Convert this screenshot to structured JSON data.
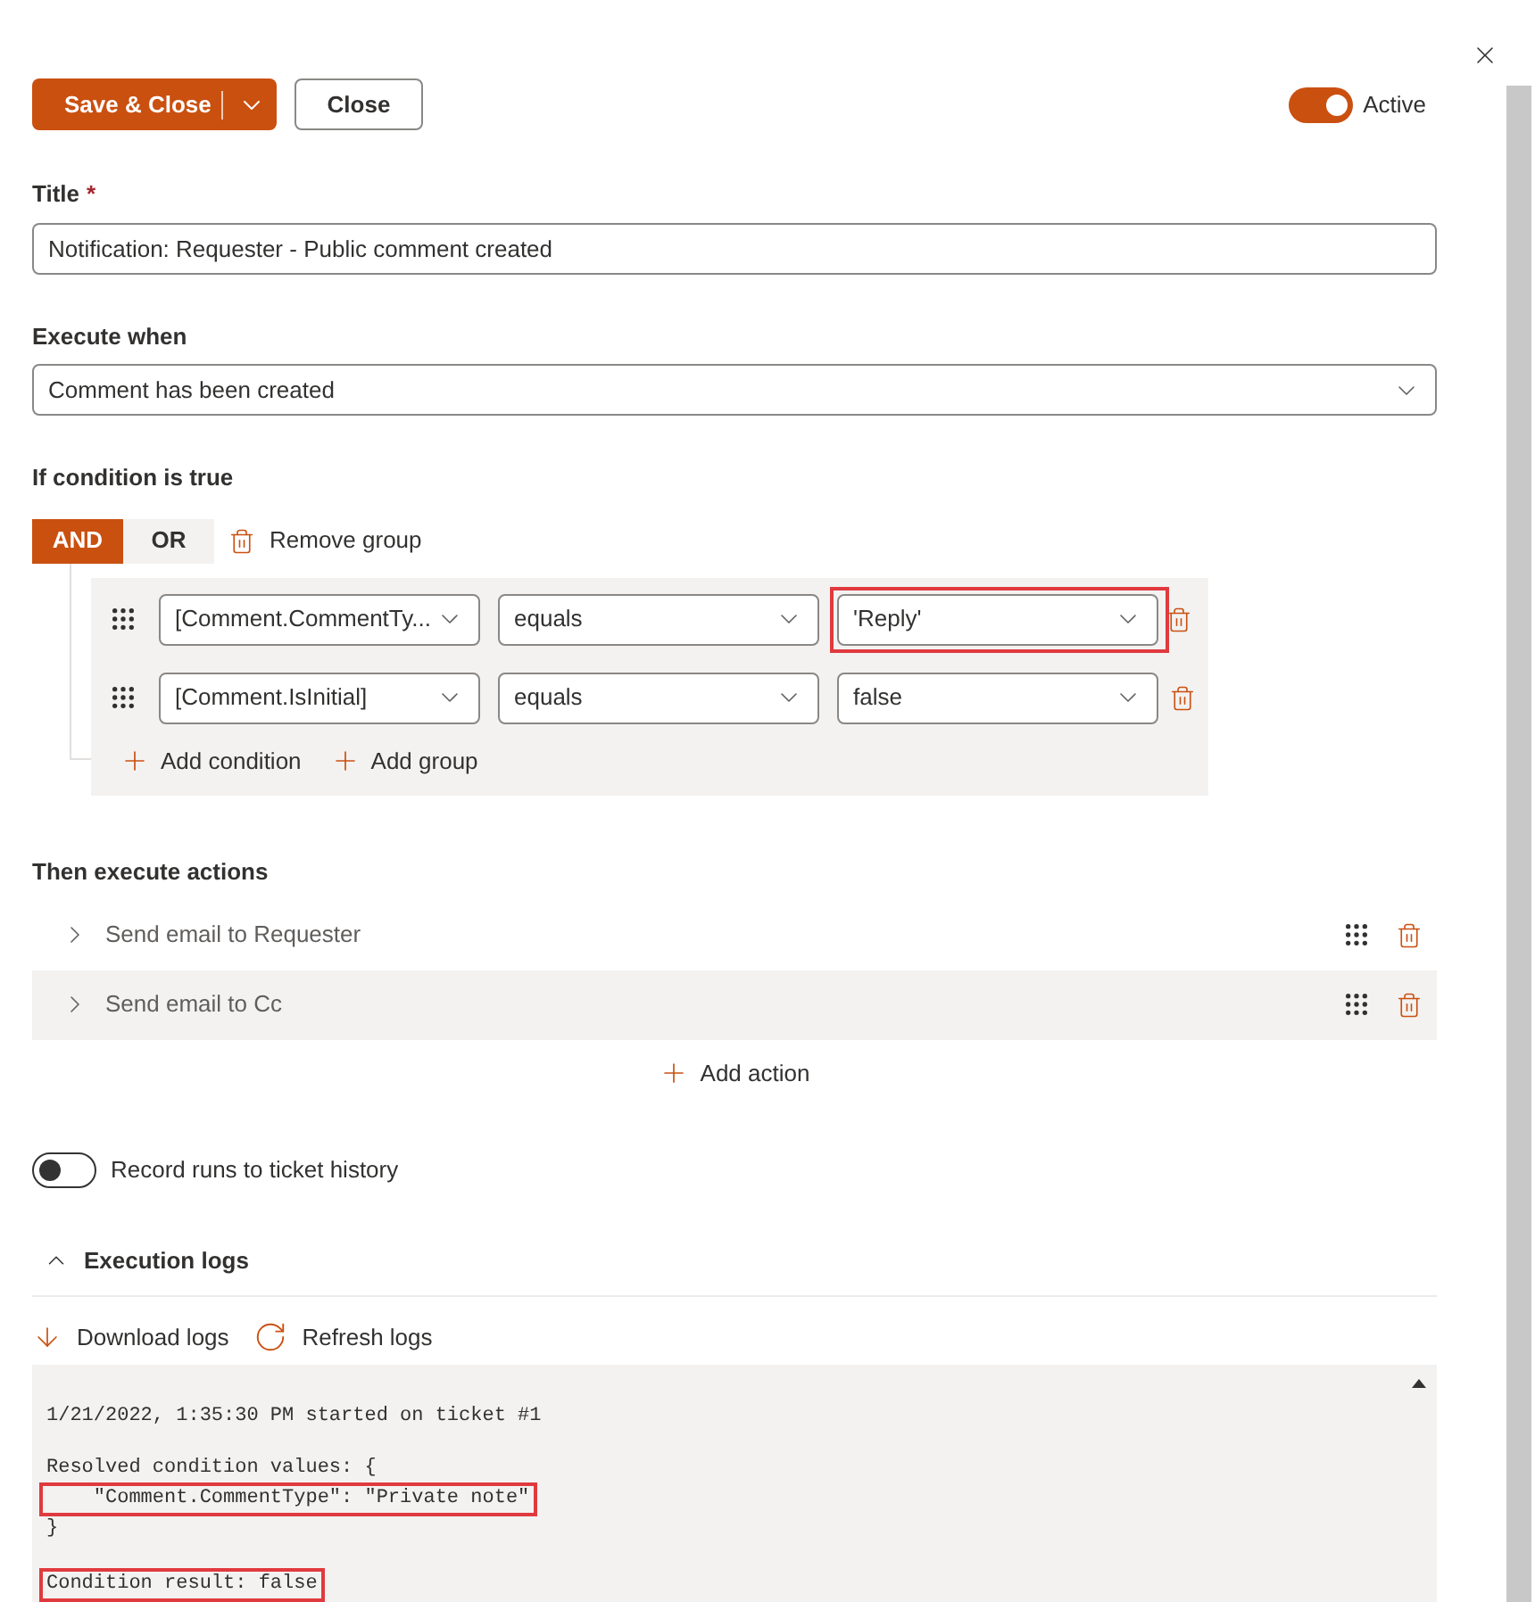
{
  "toolbar": {
    "save_button": "Save & Close",
    "close_button": "Close",
    "active": {
      "label": "Active",
      "on": true
    }
  },
  "title_field": {
    "label": "Title",
    "required_mark": "*",
    "value": "Notification: Requester - Public comment created"
  },
  "execute_when": {
    "label": "Execute when",
    "value": "Comment has been created"
  },
  "conditions": {
    "label": "If condition is true",
    "operators": [
      {
        "label": "AND",
        "selected": true
      },
      {
        "label": "OR",
        "selected": false
      }
    ],
    "remove_group": "Remove group",
    "rows": [
      {
        "field": "[Comment.CommentTy...",
        "operator": "equals",
        "value": "'Reply'",
        "highlighted": true
      },
      {
        "field": "[Comment.IsInitial]",
        "operator": "equals",
        "value": "false",
        "highlighted": false
      }
    ],
    "add_condition": "Add condition",
    "add_group": "Add group"
  },
  "actions": {
    "label": "Then execute actions",
    "items": [
      {
        "label": "Send email to Requester",
        "selected": false
      },
      {
        "label": "Send email to Cc",
        "selected": true
      }
    ],
    "add_action": "Add action"
  },
  "record_runs": {
    "label": "Record runs to ticket history",
    "on": false
  },
  "logs": {
    "label": "Execution logs",
    "expanded": true,
    "download": "Download logs",
    "refresh": "Refresh logs",
    "blocks": [
      [
        {
          "text": "1/21/2022, 1:35:30 PM started on ticket #1",
          "highlighted": false
        }
      ],
      [
        {
          "text": "Resolved condition values: {",
          "highlighted": false
        },
        {
          "text": "    \"Comment.CommentType\": \"Private note\"",
          "highlighted": true
        },
        {
          "text": "}",
          "highlighted": false
        }
      ],
      [
        {
          "text": "Condition result: false",
          "highlighted": true
        }
      ]
    ]
  }
}
